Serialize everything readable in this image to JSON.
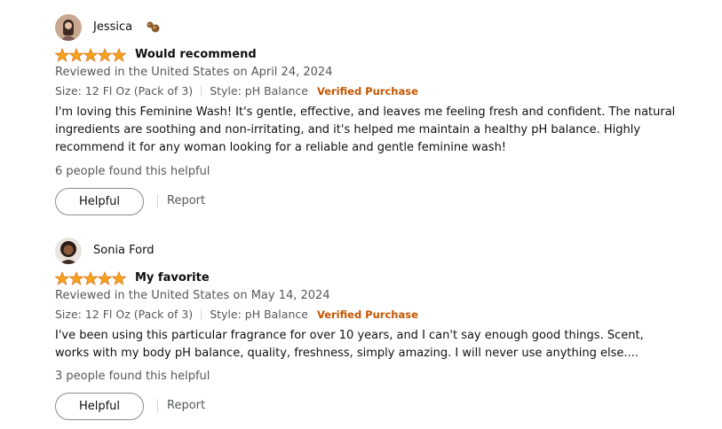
{
  "reviews": [
    {
      "profile_name": "Jessica",
      "has_badge": true,
      "rating": 5,
      "title": "Would recommend",
      "date": "Reviewed in the United States on April 24, 2024",
      "size": "Size: 12 Fl Oz (Pack of 3)",
      "style": "Style: pH Balance",
      "verified": "Verified Purchase",
      "body": "I'm loving this Feminine Wash! It's gentle, effective, and leaves me feeling fresh and confident. The natural ingredients are soothing and non-irritating, and it's helped me maintain a healthy pH balance. Highly recommend it for any woman looking for a reliable and gentle feminine wash!",
      "helpful_count": "6 people found this helpful",
      "helpful_button": "Helpful",
      "report": "Report"
    },
    {
      "profile_name": "Sonia Ford",
      "has_badge": false,
      "rating": 5,
      "title": "My favorite",
      "date": "Reviewed in the United States on May 14, 2024",
      "size": "Size: 12 Fl Oz (Pack of 3)",
      "style": "Style: pH Balance",
      "verified": "Verified Purchase",
      "body": "I've been using this particular fragrance for over 10 years, and I can't say enough good things. Scent, works with my body pH balance, quality, freshness, simply amazing. I will never use anything else....",
      "helpful_count": "3 people found this helpful",
      "helpful_button": "Helpful",
      "report": "Report"
    }
  ],
  "colors": {
    "star": "#f7a21b",
    "star_outline": "#de7921",
    "verified": "#c45500",
    "secondary_text": "#565959"
  }
}
